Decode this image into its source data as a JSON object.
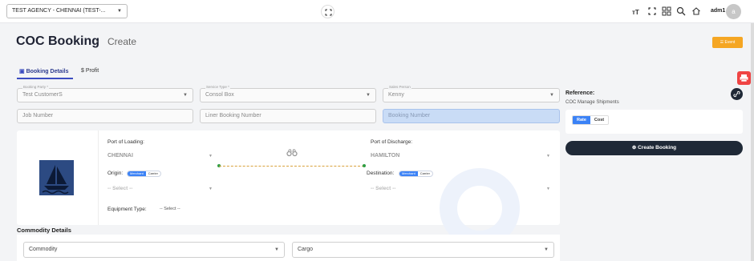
{
  "topbar": {
    "agency": "TEST AGENCY - CHENNAI (TEST-...",
    "user": "adm1",
    "avatar_initial": "a"
  },
  "header": {
    "title": "COC Booking",
    "separator": "›",
    "crumb": "Create",
    "event_button": "Event"
  },
  "tabs": [
    {
      "label": "Booking Details"
    },
    {
      "label": "Profit"
    }
  ],
  "form": {
    "booking_party": {
      "label": "Booking Party *",
      "value": "Test CustomerS"
    },
    "service_type": {
      "label": "Service Type *",
      "value": "Consol Box"
    },
    "sales_person": {
      "label": "Sales Person",
      "value": "Kenny"
    },
    "job_number": {
      "placeholder": "Job Number"
    },
    "liner_booking_number": {
      "placeholder": "Liner Booking Number"
    },
    "booking_number": {
      "placeholder": "Booking Number"
    }
  },
  "route": {
    "port_of_loading_label": "Port of Loading:",
    "port_of_loading": "CHENNAI",
    "port_of_discharge_label": "Port of Discharge:",
    "port_of_discharge": "HAMILTON",
    "origin_label": "Origin:",
    "destination_label": "Destination:",
    "merchant": "Merchant",
    "carrier": "Carrier",
    "select_placeholder": "-- Select --",
    "equipment_label": "Equipment Type:",
    "equipment_value": "-- Select --"
  },
  "side": {
    "reference_title": "Reference:",
    "reference_sub": "COC Manage Shipments",
    "rate": "Rate",
    "cost": "Cost",
    "create_button": "Create Booking"
  },
  "commodity": {
    "section_title": "Commodity Details",
    "commodity_placeholder": "Commodity",
    "cargo_placeholder": "Cargo"
  },
  "colors": {
    "accent": "#3b4cc0",
    "dark": "#1f2937",
    "event": "#f5a623",
    "print": "#ef4444",
    "toggle": "#3b82f6"
  }
}
